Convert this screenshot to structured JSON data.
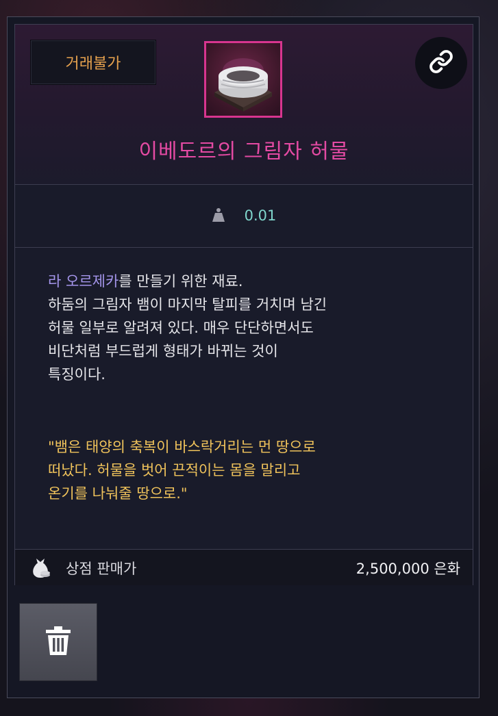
{
  "item": {
    "trade_badge": "거래불가",
    "icon": "silk-cloth-item-icon",
    "name": "이베도르의 그림자 허물",
    "weight": "0.01",
    "desc_highlight": "라 오르제카",
    "desc_line1_rest": "를 만들기 위한 재료.",
    "desc_line2": "하둠의 그림자 뱀이 마지막 탈피를 거치며 남긴",
    "desc_line3": "허물 일부로 알려져 있다. 매우 단단하면서도",
    "desc_line4": "비단처럼 부드럽게 형태가 바뀌는 것이",
    "desc_line5": "특징이다.",
    "quote_line1": "\"뱀은 태양의 축복이 바스락거리는 먼 땅으로",
    "quote_line2": "떠났다. 허물을 벗어 끈적이는 몸을 말리고",
    "quote_line3": "온기를 나눠줄 땅으로.\""
  },
  "shop": {
    "label": "상점 판매가",
    "price": "2,500,000 은화"
  },
  "icons": {
    "link": "link-icon",
    "weight": "weight-icon",
    "money_bag": "money-bag-icon",
    "trash": "trash-icon"
  },
  "colors": {
    "item_name": "#e44aa3",
    "trade_badge": "#e7a24e",
    "weight_value": "#7fd6cc",
    "desc_highlight": "#a596ec",
    "quote": "#f0c35b",
    "icon_border": "#d8358f"
  }
}
